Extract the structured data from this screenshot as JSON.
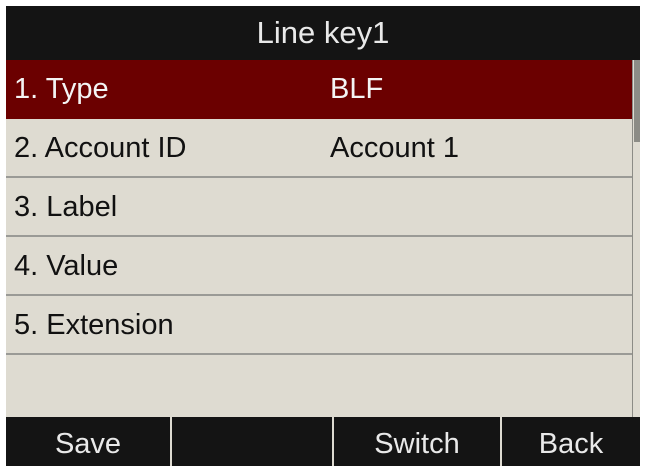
{
  "header": {
    "title": "Line key1"
  },
  "settings": {
    "items": [
      {
        "label": "1. Type",
        "value": "BLF",
        "selected": true
      },
      {
        "label": "2. Account ID",
        "value": "Account 1",
        "selected": false
      },
      {
        "label": "3. Label",
        "value": "",
        "selected": false
      },
      {
        "label": "4. Value",
        "value": "",
        "selected": false
      },
      {
        "label": "5. Extension",
        "value": "",
        "selected": false
      },
      {
        "label": "",
        "value": "",
        "selected": false
      }
    ]
  },
  "softkeys": [
    "Save",
    "",
    "Switch",
    "Back"
  ],
  "colors": {
    "background": "#141414",
    "list_background": "#dedbd1",
    "selected_row": "#6b0000",
    "divider": "#9a9a96",
    "text_light": "#e9e9e9",
    "text_dark": "#111111"
  }
}
